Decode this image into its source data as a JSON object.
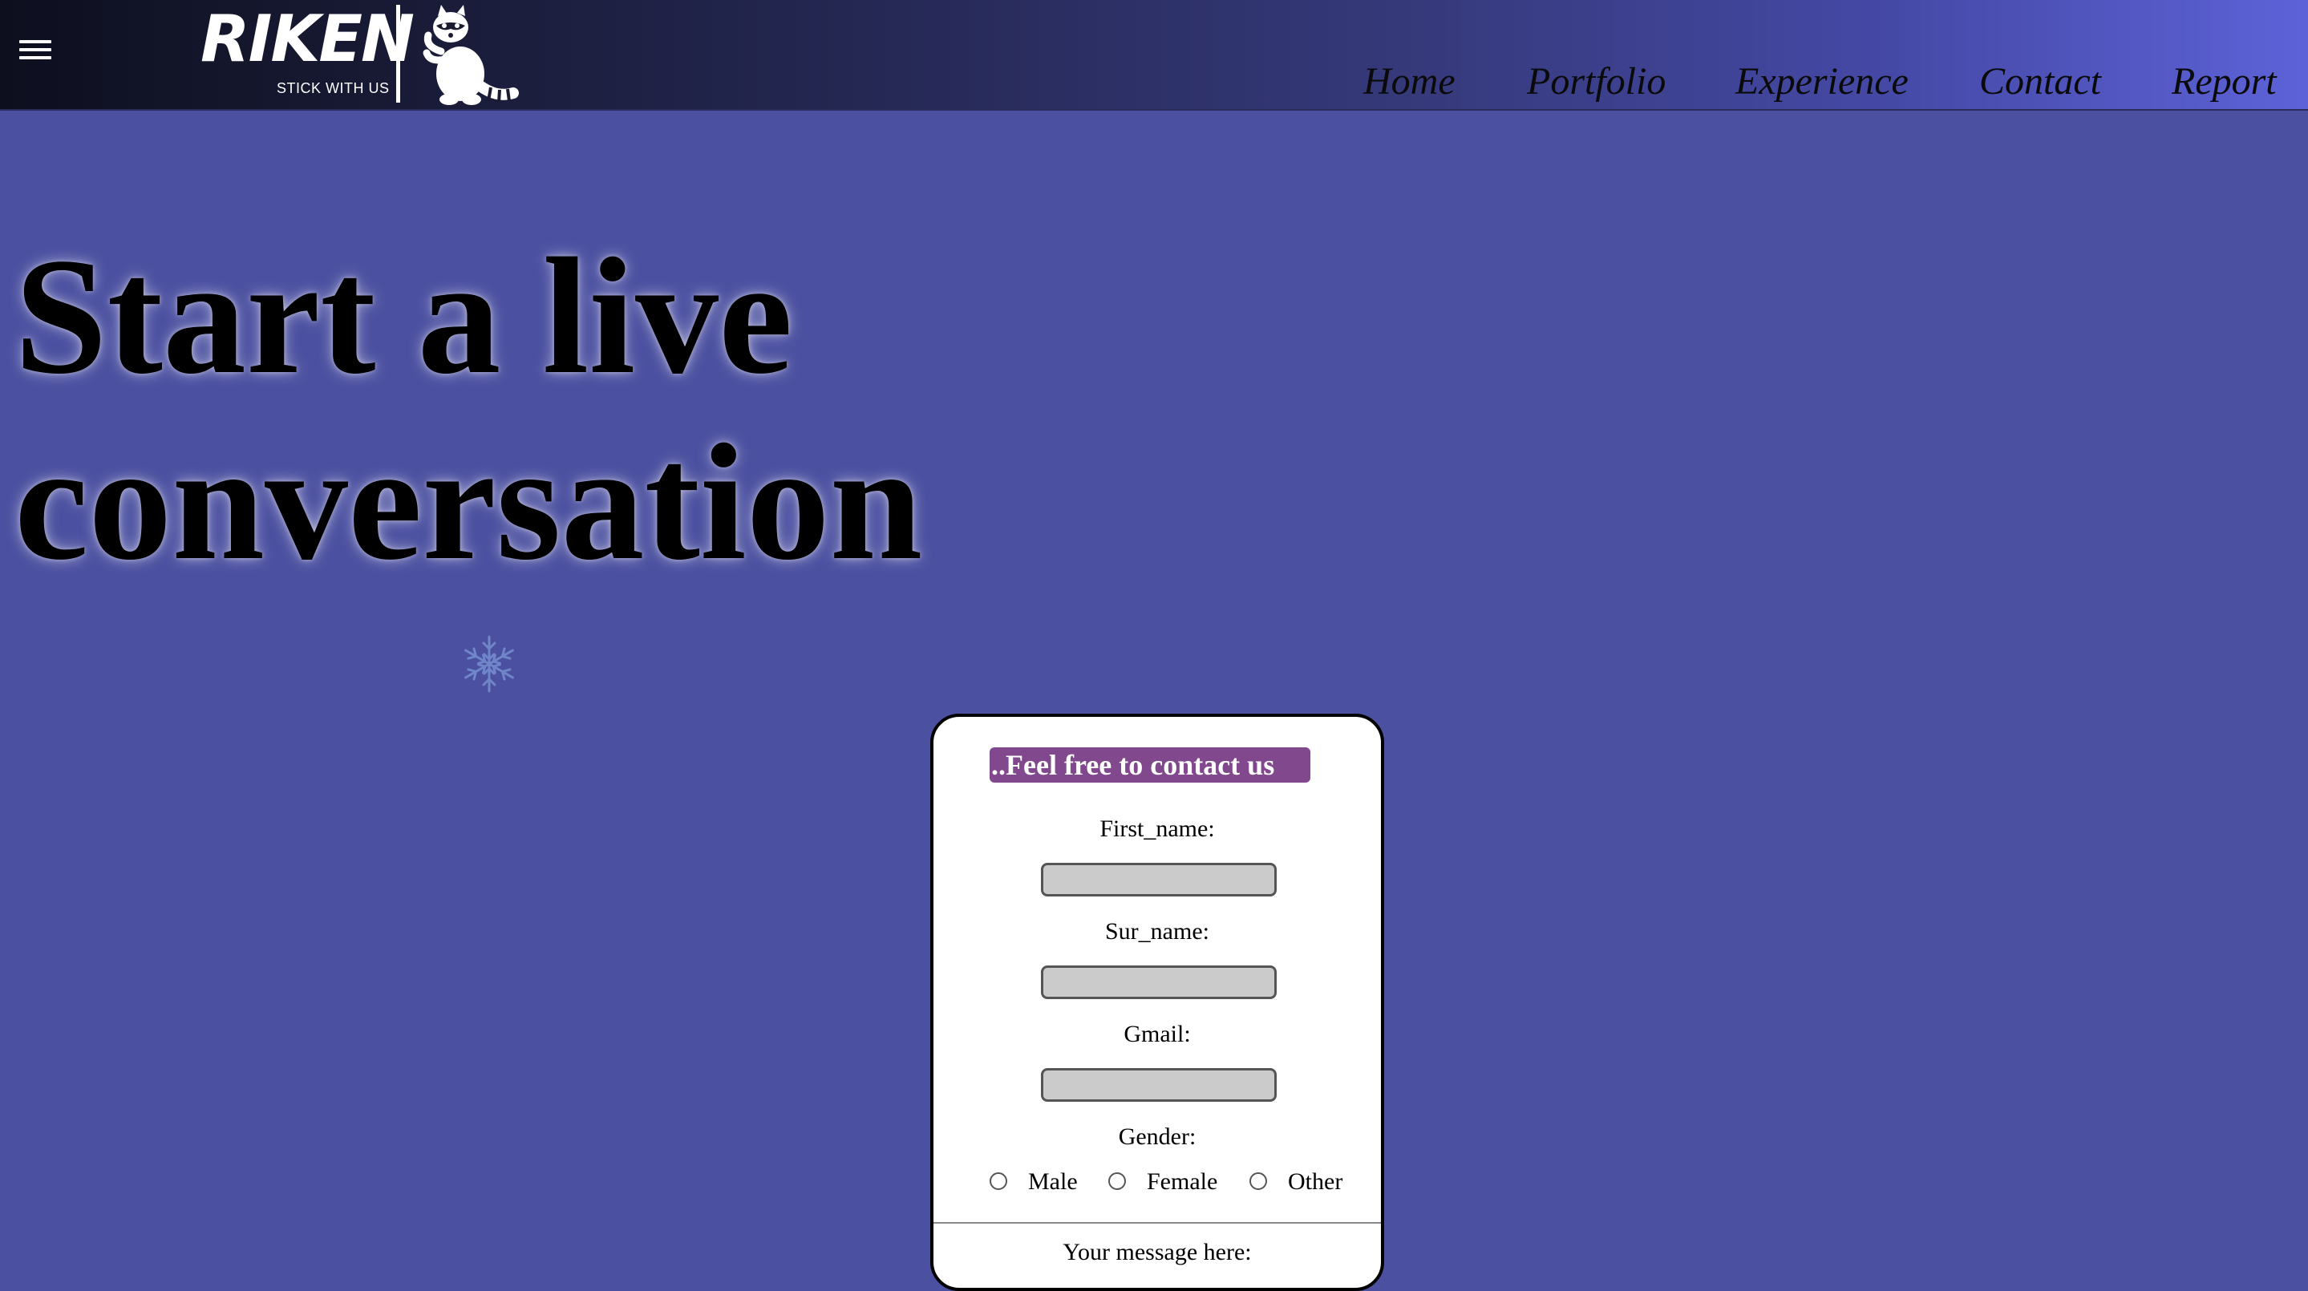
{
  "header": {
    "logo_name": "RIKEN",
    "logo_tagline": "STICK WITH US",
    "menu_icon": "hamburger-menu-icon",
    "mascot_icon": "raccoon-icon",
    "nav_items": [
      {
        "label": "Home"
      },
      {
        "label": "Portfolio"
      },
      {
        "label": "Experience"
      },
      {
        "label": "Contact"
      },
      {
        "label": "Report"
      }
    ]
  },
  "hero": {
    "title_line1": "Start a live",
    "title_line2": "conversation",
    "decoration_icon": "snowflake-icon"
  },
  "contact_form": {
    "heading": "..Feel free to contact us",
    "first_name_label": "First_name:",
    "first_name_value": "",
    "sur_name_label": "Sur_name:",
    "sur_name_value": "",
    "gmail_label": "Gmail:",
    "gmail_value": "",
    "gender_label": "Gender:",
    "gender_options": [
      "Male",
      "Female",
      "Other"
    ],
    "message_label": "Your message here:"
  },
  "colors": {
    "page_background": "#4b50a0",
    "navbar_gradient_start": "#0d0f1f",
    "navbar_gradient_end": "#5d62d8",
    "form_heading_background": "#82488e",
    "input_background": "#cbcbcb"
  }
}
